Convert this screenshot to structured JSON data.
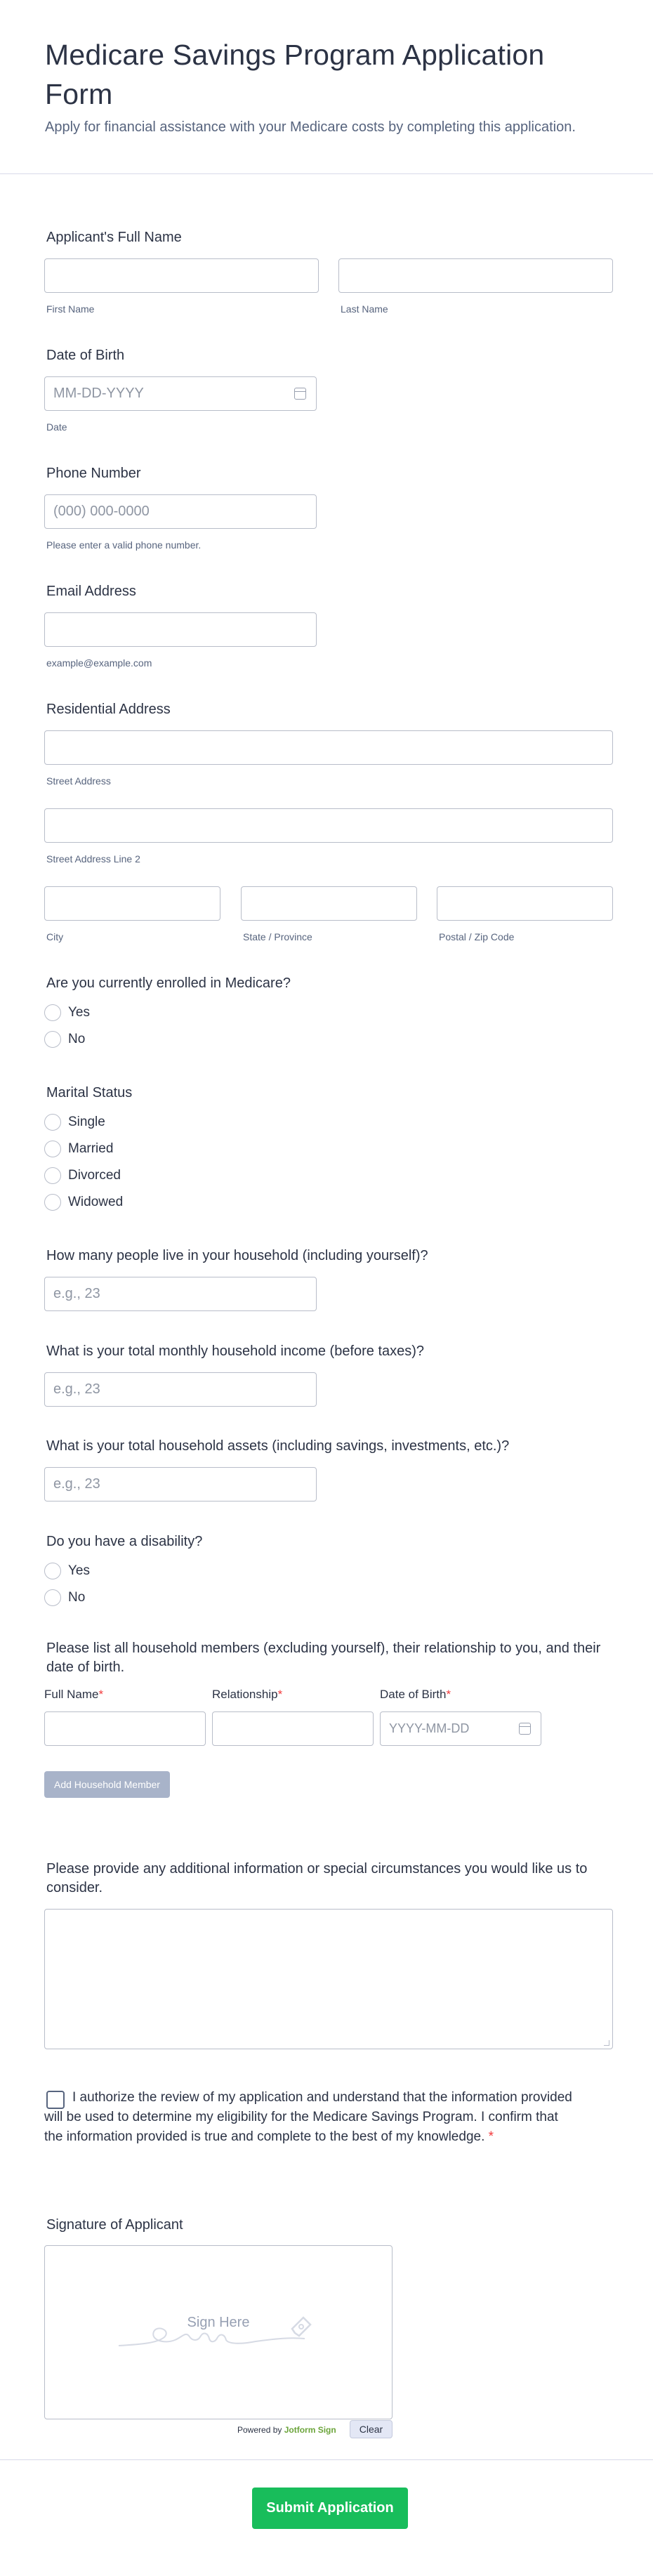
{
  "header": {
    "title": "Medicare Savings Program Application Form",
    "subtitle": "Apply for financial assistance with your Medicare costs by completing this application."
  },
  "name": {
    "label": "Applicant's Full Name",
    "first_sublabel": "First Name",
    "last_sublabel": "Last Name"
  },
  "dob": {
    "label": "Date of Birth",
    "placeholder": "MM-DD-YYYY",
    "sublabel": "Date"
  },
  "phone": {
    "label": "Phone Number",
    "placeholder": "(000) 000-0000",
    "sublabel": "Please enter a valid phone number."
  },
  "email": {
    "label": "Email Address",
    "sublabel": "example@example.com"
  },
  "address": {
    "label": "Residential Address",
    "street_sublabel": "Street Address",
    "street2_sublabel": "Street Address Line 2",
    "city_sublabel": "City",
    "state_sublabel": "State / Province",
    "zip_sublabel": "Postal / Zip Code"
  },
  "medicare": {
    "label": "Are you currently enrolled in Medicare?",
    "options": [
      "Yes",
      "No"
    ]
  },
  "marital": {
    "label": "Marital Status",
    "options": [
      "Single",
      "Married",
      "Divorced",
      "Widowed"
    ]
  },
  "household_size": {
    "label": "How many people live in your household (including yourself)?",
    "placeholder": "e.g., 23"
  },
  "income": {
    "label": "What is your total monthly household income (before taxes)?",
    "placeholder": "e.g., 23"
  },
  "assets": {
    "label": "What is your total household assets (including savings, investments, etc.)?",
    "placeholder": "e.g., 23"
  },
  "disability": {
    "label": "Do you have a disability?",
    "options": [
      "Yes",
      "No"
    ]
  },
  "members": {
    "label": "Please list all household members (excluding yourself), their relationship to you, and their date of birth.",
    "col_name": "Full Name",
    "col_relationship": "Relationship",
    "col_dob": "Date of Birth",
    "required_mark": "*",
    "dob_placeholder": "YYYY-MM-DD",
    "add_button": "Add Household Member"
  },
  "additional": {
    "label": "Please provide any additional information or special circumstances you would like us to consider."
  },
  "consent": {
    "text": "I authorize the review of my application and understand that the information provided will be used to determine my eligibility for the Medicare Savings Program. I confirm that the information provided is true and complete to the best of my knowledge.",
    "required_mark": "*"
  },
  "signature": {
    "label": "Signature of Applicant",
    "hint": "Sign Here",
    "powered_prefix": "Powered by",
    "powered_brand": "Jotform Sign",
    "clear_button": "Clear"
  },
  "submit": {
    "label": "Submit Application"
  },
  "colors": {
    "submit": "#18bd5b",
    "text": "#2c3345",
    "required": "#f23a3c",
    "border": "#b8bdc9"
  }
}
